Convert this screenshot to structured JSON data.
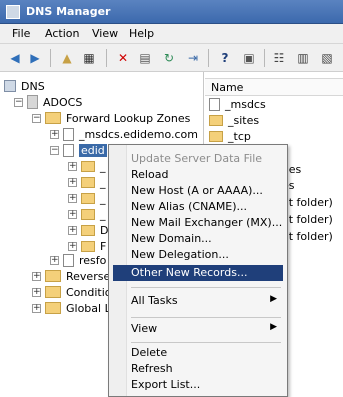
{
  "window": {
    "title": "DNS Manager"
  },
  "menu": {
    "items": [
      "File",
      "Action",
      "View",
      "Help"
    ]
  },
  "toolbar": {
    "buttons": [
      "back-arrow",
      "forward-arrow",
      "up-folder",
      "show-hide",
      "delete",
      "properties",
      "refresh",
      "export",
      "help",
      "console",
      "list",
      "details"
    ]
  },
  "tree": {
    "root": "DNS",
    "server": "ADOCS",
    "forward_zones": "Forward Lookup Zones",
    "zone_msdcs": "_msdcs.edidemo.com",
    "zone_selected": "edid",
    "child_letters": [
      "_",
      "_",
      "_",
      "_",
      "D",
      "F"
    ],
    "resfo": "resfo",
    "reverse": "Reverse",
    "condition": "Conditio",
    "global": "Global Lo"
  },
  "list": {
    "header": "Name",
    "items": [
      "_msdcs",
      "_sites",
      "_tcp"
    ],
    "partial_right": [
      "ones",
      "nes",
      "ent folder)",
      "ent folder)",
      "ent folder)"
    ]
  },
  "context_menu": {
    "items": [
      {
        "label": "Update Server Data File",
        "disabled": true
      },
      {
        "label": "Reload"
      },
      {
        "label": "New Host (A or AAAA)..."
      },
      {
        "label": "New Alias (CNAME)..."
      },
      {
        "label": "New Mail Exchanger (MX)..."
      },
      {
        "label": "New Domain..."
      },
      {
        "label": "New Delegation..."
      },
      {
        "label": "Other New Records...",
        "highlight": true
      },
      {
        "label": "All Tasks",
        "submenu": true
      },
      {
        "label": "View",
        "submenu": true
      },
      {
        "label": "Delete"
      },
      {
        "label": "Refresh"
      },
      {
        "label": "Export List..."
      }
    ]
  },
  "colors": {
    "titlebar": "#4a76b6",
    "highlight": "#1f3f7a",
    "selection": "#3a6aa8"
  }
}
